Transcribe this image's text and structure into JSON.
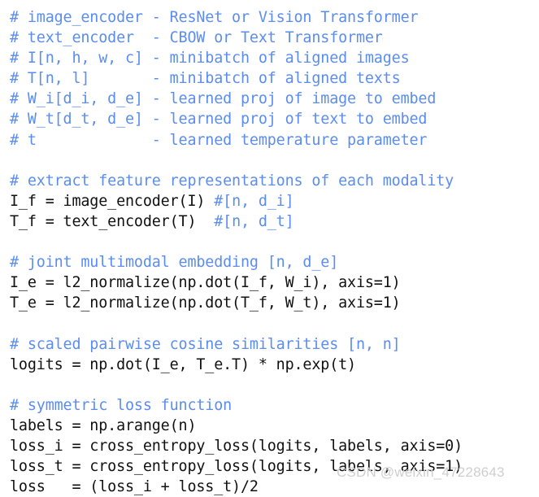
{
  "colors": {
    "background": "#ffffff",
    "comment": "#5b8df0",
    "code": "#111111",
    "watermark": "#cfcfcf"
  },
  "code_block": {
    "language": "python",
    "lines": [
      {
        "type": "comment",
        "text": "# image_encoder - ResNet or Vision Transformer"
      },
      {
        "type": "comment",
        "text": "# text_encoder  - CBOW or Text Transformer"
      },
      {
        "type": "comment",
        "text": "# I[n, h, w, c] - minibatch of aligned images"
      },
      {
        "type": "comment",
        "text": "# T[n, l]       - minibatch of aligned texts"
      },
      {
        "type": "comment",
        "text": "# W_i[d_i, d_e] - learned proj of image to embed"
      },
      {
        "type": "comment",
        "text": "# W_t[d_t, d_e] - learned proj of text to embed"
      },
      {
        "type": "comment",
        "text": "# t             - learned temperature parameter"
      },
      {
        "type": "blank",
        "text": ""
      },
      {
        "type": "comment",
        "text": "# extract feature representations of each modality"
      },
      {
        "type": "mixed",
        "code": "I_f = image_encoder(I) ",
        "comment": "#[n, d_i]"
      },
      {
        "type": "mixed",
        "code": "T_f = text_encoder(T)  ",
        "comment": "#[n, d_t]"
      },
      {
        "type": "blank",
        "text": ""
      },
      {
        "type": "comment",
        "text": "# joint multimodal embedding [n, d_e]"
      },
      {
        "type": "code",
        "text": "I_e = l2_normalize(np.dot(I_f, W_i), axis=1)"
      },
      {
        "type": "code",
        "text": "T_e = l2_normalize(np.dot(T_f, W_t), axis=1)"
      },
      {
        "type": "blank",
        "text": ""
      },
      {
        "type": "comment",
        "text": "# scaled pairwise cosine similarities [n, n]"
      },
      {
        "type": "code",
        "text": "logits = np.dot(I_e, T_e.T) * np.exp(t)"
      },
      {
        "type": "blank",
        "text": ""
      },
      {
        "type": "comment",
        "text": "# symmetric loss function"
      },
      {
        "type": "code",
        "text": "labels = np.arange(n)"
      },
      {
        "type": "code",
        "text": "loss_i = cross_entropy_loss(logits, labels, axis=0)"
      },
      {
        "type": "code",
        "text": "loss_t = cross_entropy_loss(logits, labels, axis=1)"
      },
      {
        "type": "code",
        "text": "loss   = (loss_i + loss_t)/2"
      }
    ]
  },
  "watermark": {
    "text": "CSDN @weixin_47228643"
  }
}
